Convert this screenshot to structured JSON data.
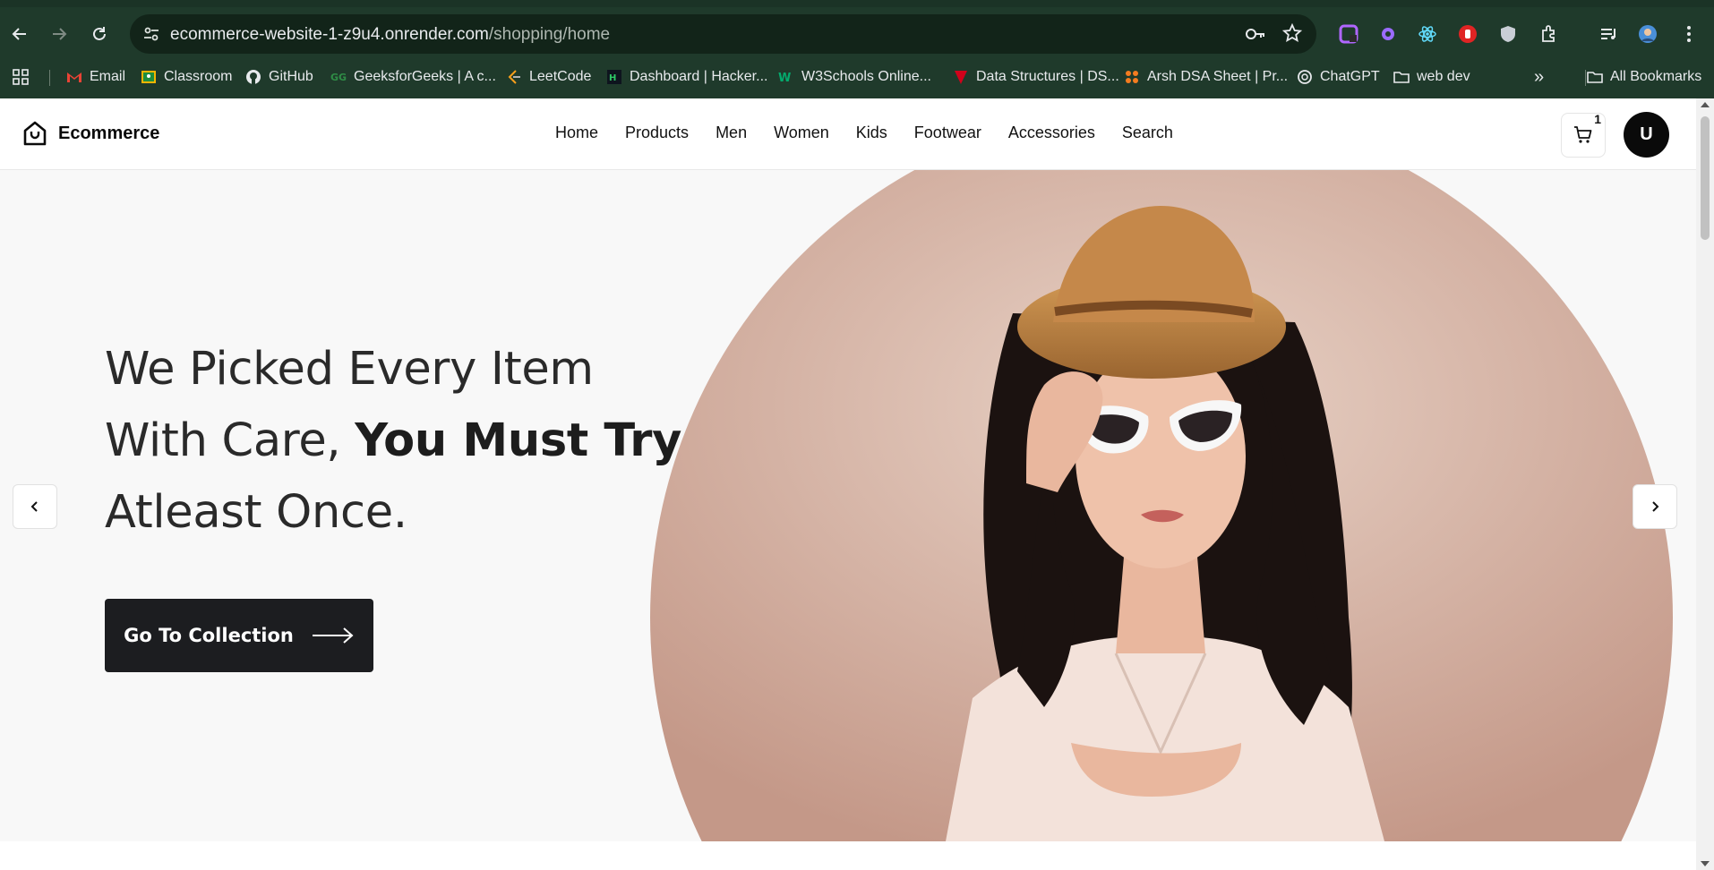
{
  "browser": {
    "url_host": "ecommerce-website-1-z9u4.onrender.com",
    "url_path": "/shopping/home",
    "bookmarks": [
      {
        "label": "Email",
        "icon": "gmail-icon"
      },
      {
        "label": "Classroom",
        "icon": "classroom-icon"
      },
      {
        "label": "GitHub",
        "icon": "github-icon"
      },
      {
        "label": "GeeksforGeeks | A c...",
        "icon": "geeksforgeeks-icon"
      },
      {
        "label": "LeetCode",
        "icon": "leetcode-icon"
      },
      {
        "label": "Dashboard | Hacker...",
        "icon": "hackerrank-icon"
      },
      {
        "label": "W3Schools Online...",
        "icon": "w3schools-icon"
      },
      {
        "label": "Data Structures | DS...",
        "icon": "data-structures-icon"
      },
      {
        "label": "Arsh DSA Sheet | Pr...",
        "icon": "arsh-icon"
      },
      {
        "label": "ChatGPT",
        "icon": "chatgpt-icon"
      },
      {
        "label": "web dev",
        "icon": "folder-icon"
      }
    ],
    "more_bookmarks": "»",
    "all_bookmarks": "All Bookmarks"
  },
  "site": {
    "brand": "Ecommerce",
    "nav": [
      "Home",
      "Products",
      "Men",
      "Women",
      "Kids",
      "Footwear",
      "Accessories",
      "Search"
    ],
    "cart_count": "1",
    "avatar_initial": "U"
  },
  "hero": {
    "line1": "We Picked Every Item",
    "line2_normal": "With Care, ",
    "line2_bold": "You Must Try",
    "line3": "Atleast Once.",
    "cta_label": "Go To Collection"
  },
  "colors": {
    "chrome_bg": "#1f3a2b",
    "omnibox_bg": "#122419",
    "hero_bg": "#f8f8f8",
    "cta_bg": "#1c1d20",
    "photo_circle": "#d9b8a8"
  }
}
